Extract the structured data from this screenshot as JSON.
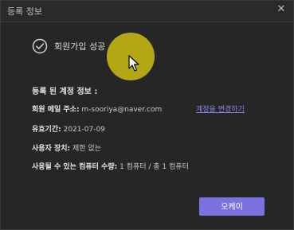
{
  "window": {
    "title": "등록 정보",
    "close_glyph": "✕"
  },
  "status": {
    "icon": "check-circle-icon",
    "message": "회원가입 성공"
  },
  "account": {
    "heading": "등록 된 계정 정보 :",
    "email_label": "회원 메일 주소:",
    "email_value": "m-sooriya@naver.com",
    "change_link": "계정을 변경하기",
    "period_label": "유효기간:",
    "period_value": "2021-07-09",
    "device_label": "사용자 장치:",
    "device_value": "제한 없는",
    "computers_label": "사용될 수 있는 컴퓨터 수량:",
    "computers_value": "1 컴퓨터 / 총 1 컴퓨터"
  },
  "actions": {
    "ok_label": "오케이"
  },
  "colors": {
    "accent": "#7b72e0",
    "link": "#8a86e8",
    "background": "#262626",
    "cursor_highlight": "#cdbe14"
  }
}
